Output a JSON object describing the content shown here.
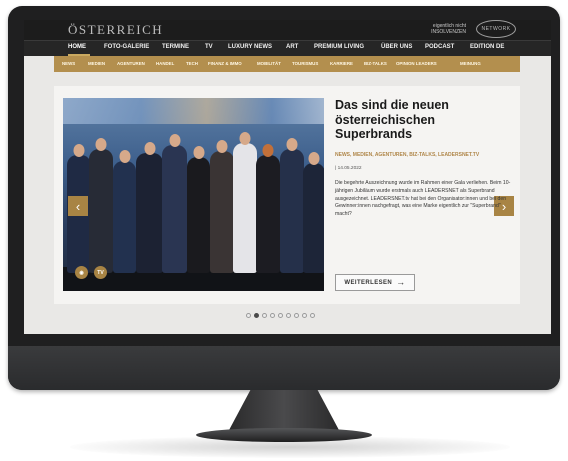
{
  "site": {
    "logo": "ÖSTERREICH",
    "logo_small": "eigentlich nicht\nINSOLVENZEN",
    "logo_round": "NETWORK"
  },
  "nav": {
    "items": [
      "HOME",
      "FOTO-GALERIE",
      "TERMINE",
      "TV",
      "LUXURY NEWS",
      "ART",
      "PREMIUM LIVING",
      "ÜBER UNS",
      "PODCAST",
      "EDITION DE"
    ],
    "active": "HOME"
  },
  "subnav": {
    "items": [
      "NEWS",
      "MEDIEN",
      "AGENTUREN",
      "HANDEL",
      "TECH",
      "FINANZ & IMMO",
      "MOBILITÄT",
      "TOURISMUS",
      "KARRIERE",
      "BIZ-TALKS",
      "OPINION LEADERS",
      "MEINUNG"
    ]
  },
  "article": {
    "headline": "Das sind die neuen österreichischen Superbrands",
    "meta": "NEWS, MEDIEN, AGENTUREN, BIZ-TALKS, LEADERSNET.TV",
    "date": "| 14.05.2022",
    "excerpt": "Die begehrte Auszeichnung wurde im Rahmen einer Gala verliehen. Beim 10-jährigen Jubiläum wurde erstmals auch LEADERSNET als Superbrand ausgezeichnet. LEADERSNET.tv hat bei den Organisator:innen und bei den Gewinner:innen nachgefragt, was eine Marke eigentlich zur \"Superbrand\" macht?",
    "read_more": "WEITERLESEN",
    "photo_icons": [
      "camera-icon",
      "tv-icon"
    ],
    "tv_label": "TV"
  },
  "carousel": {
    "total": 9,
    "active_index": 1
  },
  "colors": {
    "accent": "#b38f4e",
    "nav_bg": "#262626",
    "headline": "#1a1a1a"
  }
}
